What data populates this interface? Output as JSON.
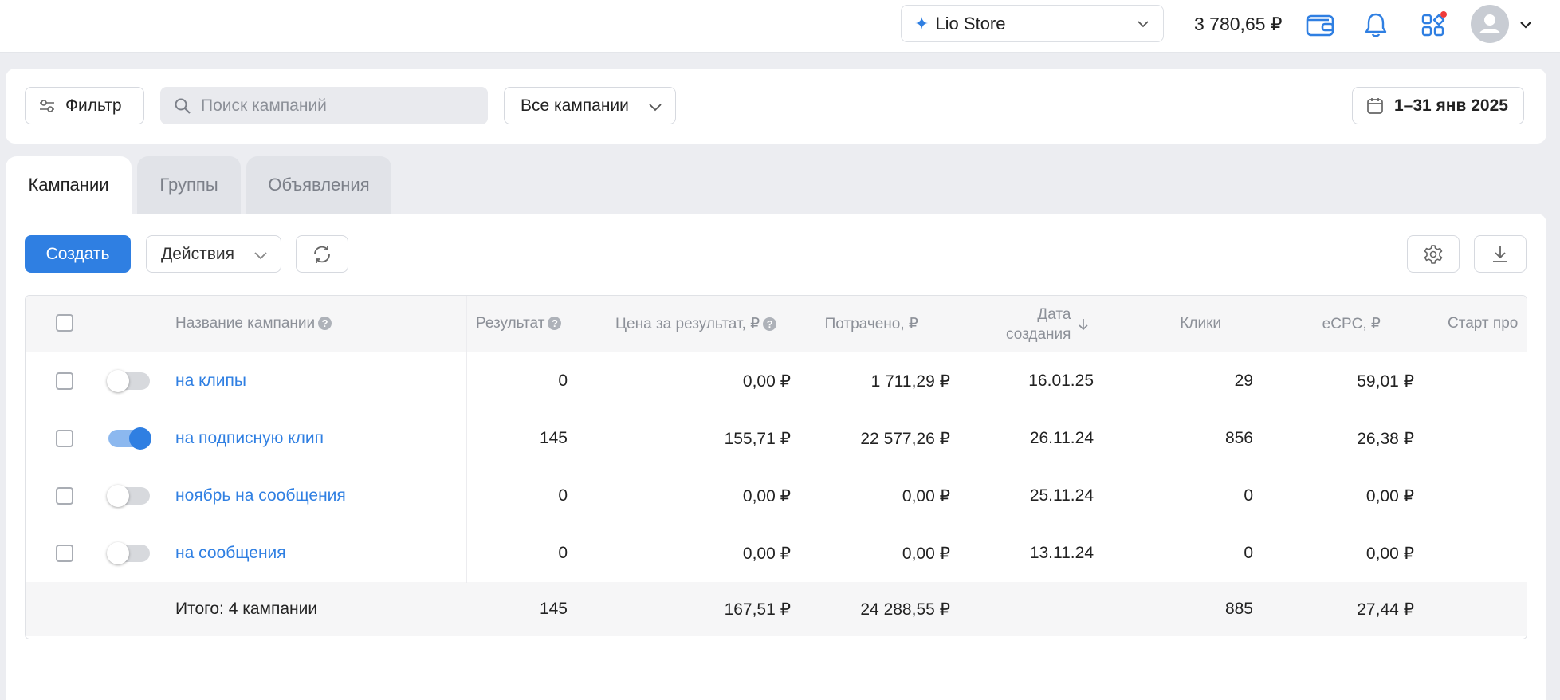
{
  "header": {
    "store_icon": "sparkle-icon",
    "store_name": "Lio Store",
    "balance": "3 780,65 ₽",
    "icons": [
      "wallet-icon",
      "bell-icon",
      "apps-grid-icon",
      "avatar-icon",
      "chevron-down-icon"
    ],
    "notification_dot_color": "#ef3b3b"
  },
  "filters": {
    "filter_label": "Фильтр",
    "search_placeholder": "Поиск кампаний",
    "all_campaigns_label": "Все кампании",
    "date_range": "1–31 янв 2025"
  },
  "tabs": [
    {
      "label": "Кампании",
      "active": true
    },
    {
      "label": "Группы",
      "active": false
    },
    {
      "label": "Объявления",
      "active": false
    }
  ],
  "toolbar": {
    "create_label": "Создать",
    "actions_label": "Действия",
    "accent_color": "#2f7fe2"
  },
  "table": {
    "headers": {
      "name": "Название кампании",
      "result": "Результат",
      "cost_per_result": "Цена за результат, ₽",
      "spent": "Потрачено, ₽",
      "created_line1": "Дата",
      "created_line2": "создания",
      "clicks": "Клики",
      "ecpc": "eCPC, ₽",
      "start": "Старт про"
    },
    "rows": [
      {
        "name": "на клипы",
        "active": false,
        "result": "0",
        "cost_per_result": "0,00 ₽",
        "spent": "1 711,29 ₽",
        "created": "16.01.25",
        "clicks": "29",
        "ecpc": "59,01 ₽"
      },
      {
        "name": "на подписную клип",
        "active": true,
        "result": "145",
        "cost_per_result": "155,71 ₽",
        "spent": "22 577,26 ₽",
        "created": "26.11.24",
        "clicks": "856",
        "ecpc": "26,38 ₽"
      },
      {
        "name": "ноябрь на сообщения",
        "active": false,
        "result": "0",
        "cost_per_result": "0,00 ₽",
        "spent": "0,00 ₽",
        "created": "25.11.24",
        "clicks": "0",
        "ecpc": "0,00 ₽"
      },
      {
        "name": "на сообщения",
        "active": false,
        "result": "0",
        "cost_per_result": "0,00 ₽",
        "spent": "0,00 ₽",
        "created": "13.11.24",
        "clicks": "0",
        "ecpc": "0,00 ₽"
      }
    ],
    "total": {
      "label": "Итого: 4 кампании",
      "result": "145",
      "cost_per_result": "167,51 ₽",
      "spent": "24 288,55 ₽",
      "clicks": "885",
      "ecpc": "27,44 ₽"
    }
  }
}
